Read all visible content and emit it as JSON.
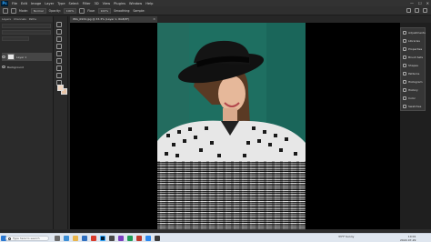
{
  "menu": [
    "File",
    "Edit",
    "Image",
    "Layer",
    "Type",
    "Select",
    "Filter",
    "3D",
    "View",
    "Plugins",
    "Window",
    "Help"
  ],
  "window_controls": [
    "—",
    "☐",
    "✕"
  ],
  "options_bar": {
    "fields": [
      "Normal",
      "Opacity:",
      "100%",
      "Flow:",
      "100%"
    ],
    "labels": [
      "Mode:",
      "Smoothing:",
      "Sample:"
    ]
  },
  "document": {
    "tab_title": "IMG_0934.jpg @ 33.3% (Layer 1, RGB/8*)",
    "close": "×"
  },
  "layers_panel": {
    "tabs": [
      "Layers",
      "Channels",
      "Paths"
    ],
    "layers": [
      {
        "name": "Layer 1",
        "active": true
      },
      {
        "name": "Background",
        "active": false
      }
    ]
  },
  "right_panel_items": [
    "Adjustments",
    "Libraries",
    "Properties",
    "Brush Sets",
    "Shapes",
    "Patterns",
    "Histogram",
    "History",
    "Color",
    "Swatches"
  ],
  "taskbar": {
    "search_placeholder": "Type here to search",
    "weather": "33°F Sunny",
    "time": "10:01",
    "date": "2022-07-29"
  }
}
